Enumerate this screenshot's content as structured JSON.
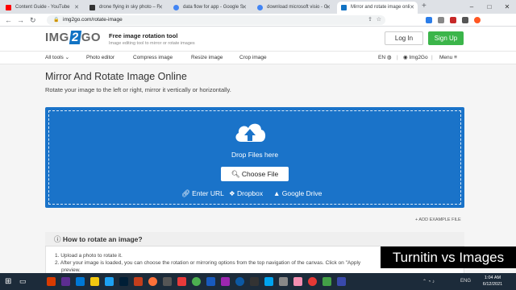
{
  "browser": {
    "tabs": [
      {
        "title": "Content Guide - YouTube",
        "favicon_color": "#ff0000"
      },
      {
        "title": "drone flying in sky photo – F",
        "favicon_color": "#333333"
      },
      {
        "title": "data flow for app - Google S",
        "favicon_color": "#4285f4"
      },
      {
        "title": "download microsoft visio - G",
        "favicon_color": "#4285f4"
      },
      {
        "title": "Mirror and rotate image onli",
        "favicon_color": "#1173c4"
      }
    ],
    "new_tab": "+",
    "url": "img2go.com/rotate-image",
    "minimize": "–",
    "maximize": "□",
    "close": "✕"
  },
  "site": {
    "logo_left": "IMG",
    "logo_mid": "2",
    "logo_right": "GO",
    "tagline_title": "Free image rotation tool",
    "tagline_sub": "Image editing tool to mirror or rotate images",
    "login": "Log In",
    "signup": "Sign Up",
    "nav": [
      "All tools",
      "Photo editor",
      "Compress image",
      "Resize image",
      "Crop image"
    ],
    "lang": "EN",
    "brand_link": "Img2Go",
    "menu": "Menu"
  },
  "page": {
    "title": "Mirror And Rotate Image Online",
    "subtitle": "Rotate your image to the left or right, mirror it vertically or horizontally.",
    "drop_text": "Drop Files here",
    "choose_file": "Choose File",
    "enter_url": "Enter URL",
    "dropbox": "Dropbox",
    "google_drive": "Google Drive",
    "add_example": "+ ADD EXAMPLE FILE",
    "how_title": "How to rotate an image?",
    "steps": [
      "1. Upload a photo to rotate it.",
      "2. After your image is loaded, you can choose the rotation or mirroring options from the top navigation of the canvas. Click on \"Apply",
      "preview."
    ]
  },
  "overlay_caption": "Turnitin vs Images",
  "taskbar": {
    "lang": "ENG",
    "time": "1:04 AM",
    "date": "6/12/2021"
  },
  "colors": {
    "accent_blue": "#1a73c9",
    "signup_green": "#3bb54a"
  }
}
